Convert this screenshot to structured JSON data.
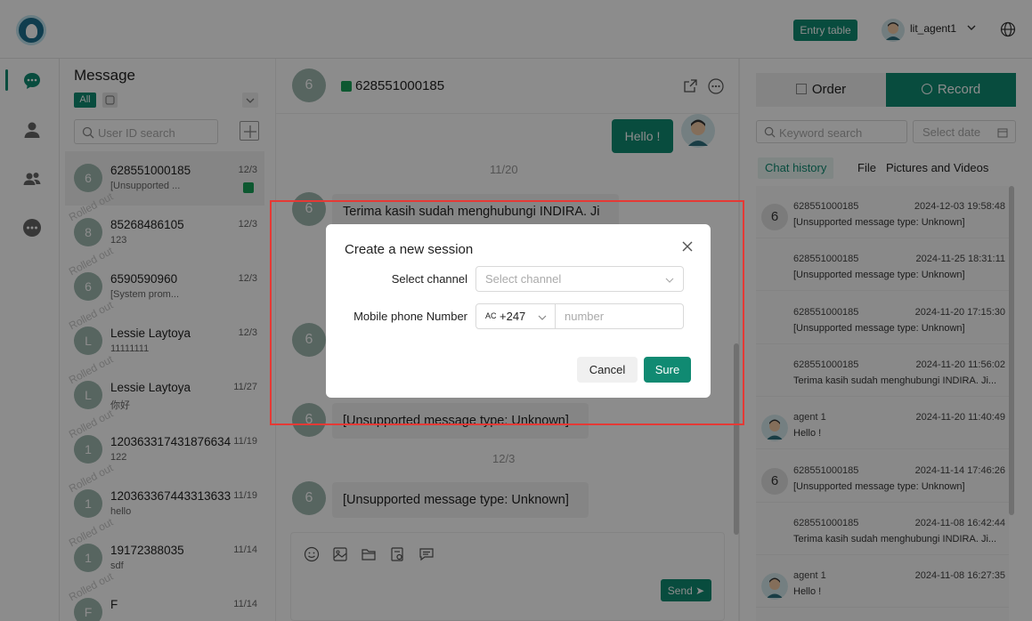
{
  "header": {
    "entry_table_label": "Entry table",
    "username": "lit_agent1"
  },
  "icons": {
    "logo": "app-logo-icon",
    "nav": [
      "chat-bubble-icon",
      "user-icon",
      "group-icon",
      "more-dots-icon"
    ],
    "composer": [
      "emoji-icon",
      "image-icon",
      "folder-icon",
      "template-icon",
      "quick-reply-icon"
    ]
  },
  "conversation_list": {
    "title": "Message",
    "filter_all": "All",
    "search_placeholder": "User ID search",
    "rolled_out_label": "Rolled out",
    "items": [
      {
        "avatar": "6",
        "name": "628551000185",
        "preview": "[Unsupported ...",
        "date": "12/3",
        "selected": true,
        "rolled": false
      },
      {
        "avatar": "8",
        "name": "85268486105",
        "preview": "123",
        "date": "12/3",
        "selected": false,
        "rolled": true
      },
      {
        "avatar": "6",
        "name": "6590590960",
        "preview": "[System prom...",
        "date": "12/3",
        "selected": false,
        "rolled": true
      },
      {
        "avatar": "L",
        "name": "Lessie Laytoya",
        "preview": "11111111",
        "date": "12/3",
        "selected": false,
        "rolled": true
      },
      {
        "avatar": "L",
        "name": "Lessie Laytoya",
        "preview": "你好",
        "date": "11/27",
        "selected": false,
        "rolled": true
      },
      {
        "avatar": "1",
        "name": "120363317431876634",
        "preview": "122",
        "date": "11/19",
        "selected": false,
        "rolled": true
      },
      {
        "avatar": "1",
        "name": "120363367443313633",
        "preview": "hello",
        "date": "11/19",
        "selected": false,
        "rolled": true
      },
      {
        "avatar": "1",
        "name": "19172388035",
        "preview": "sdf",
        "date": "11/14",
        "selected": false,
        "rolled": true
      },
      {
        "avatar": "F",
        "name": "F",
        "preview": "",
        "date": "11/14",
        "selected": false,
        "rolled": true
      }
    ]
  },
  "chat": {
    "avatar": "6",
    "title": "628551000185",
    "outgoing_text": "Hello !",
    "day_1": "11/20",
    "day_2": "12/3",
    "incoming_avatar": "6",
    "incoming_1": "Terima kasih sudah menghubungi INDIRA. Ji",
    "incoming_2": "[Unsupported message type: Unknown]",
    "incoming_3": "[Unsupported message type: Unknown]",
    "send_label": "Send ➤"
  },
  "right_panel": {
    "tab_order": "Order",
    "tab_record": "Record",
    "keyword_placeholder": "Keyword search",
    "date_placeholder": "Select date",
    "sub_tabs": [
      "Chat history",
      "File",
      "Pictures and Videos"
    ],
    "history": [
      {
        "avatar": "6",
        "agent": false,
        "name": "628551000185",
        "time": "2024-12-03 19:58:48",
        "text": "[Unsupported message type: Unknown]"
      },
      {
        "avatar": "",
        "agent": false,
        "name": "628551000185",
        "time": "2024-11-25 18:31:11",
        "text": "[Unsupported message type: Unknown]"
      },
      {
        "avatar": "",
        "agent": false,
        "name": "628551000185",
        "time": "2024-11-20 17:15:30",
        "text": "[Unsupported message type: Unknown]"
      },
      {
        "avatar": "",
        "agent": false,
        "name": "628551000185",
        "time": "2024-11-20 11:56:02",
        "text": "Terima kasih sudah menghubungi INDIRA. Ji..."
      },
      {
        "avatar": "",
        "agent": true,
        "name": "agent 1",
        "time": "2024-11-20 11:40:49",
        "text": "Hello !"
      },
      {
        "avatar": "6",
        "agent": false,
        "name": "628551000185",
        "time": "2024-11-14 17:46:26",
        "text": "[Unsupported message type: Unknown]"
      },
      {
        "avatar": "",
        "agent": false,
        "name": "628551000185",
        "time": "2024-11-08 16:42:44",
        "text": "Terima kasih sudah menghubungi INDIRA. Ji..."
      },
      {
        "avatar": "",
        "agent": true,
        "name": "agent 1",
        "time": "2024-11-08 16:27:35",
        "text": "Hello !"
      }
    ]
  },
  "modal": {
    "title": "Create a new session",
    "channel_label": "Select channel",
    "channel_placeholder": "Select channel",
    "phone_label": "Mobile phone Number",
    "country_flag": "AC",
    "country_code": "+247",
    "phone_placeholder": "number",
    "cancel_label": "Cancel",
    "sure_label": "Sure"
  },
  "colors": {
    "accent": "#108a72",
    "highlight_border": "#e53935"
  }
}
